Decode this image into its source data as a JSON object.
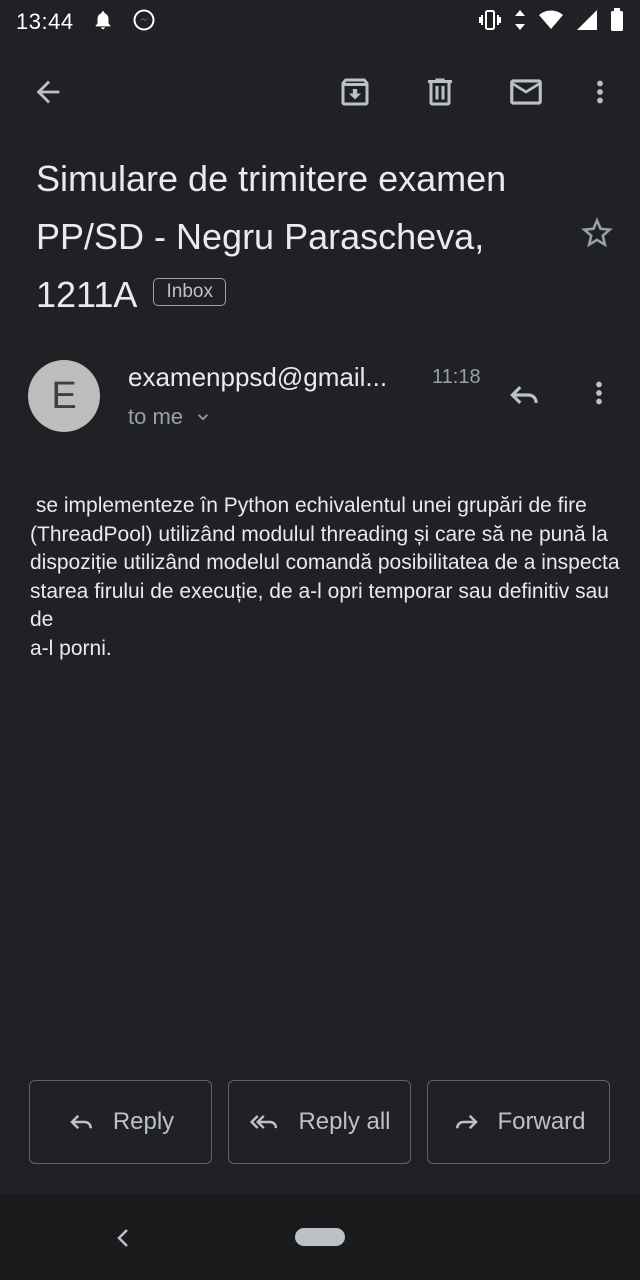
{
  "status_bar": {
    "time": "13:44",
    "left_icons": [
      "notification-bell-icon",
      "messenger-icon"
    ],
    "right_icons": [
      "vibrate-icon",
      "data-arrows-icon",
      "wifi-icon",
      "cell-signal-icon",
      "battery-icon"
    ]
  },
  "toolbar": {
    "back_icon": "arrow-back-icon",
    "archive_icon": "archive-icon",
    "delete_icon": "trash-icon",
    "mark_unread_icon": "mail-icon",
    "more_icon": "more-vert-icon"
  },
  "email": {
    "subject": "Simulare de trimitere examen PP/SD - Negru Parascheva, 1211A",
    "label": "Inbox",
    "sender_initial": "E",
    "sender": "examenppsd@gmail...",
    "time": "11:18",
    "recipient": "to me",
    "body_lines": [
      " se implementeze în Python echivalentul unei grupări de fire",
      "(ThreadPool) utilizând modulul threading și care să ne pună la",
      "dispoziție utilizând modelul comandă posibilitatea de a inspecta",
      "starea firului de execuție, de a-l opri temporar sau definitiv sau de",
      "a-l porni."
    ]
  },
  "actions": {
    "reply": "Reply",
    "reply_all": "Reply all",
    "forward": "Forward"
  },
  "colors": {
    "background": "#202124",
    "text": "#e8eaed",
    "secondary_text": "#9aa0a6",
    "avatar": "#bdbdbd"
  }
}
